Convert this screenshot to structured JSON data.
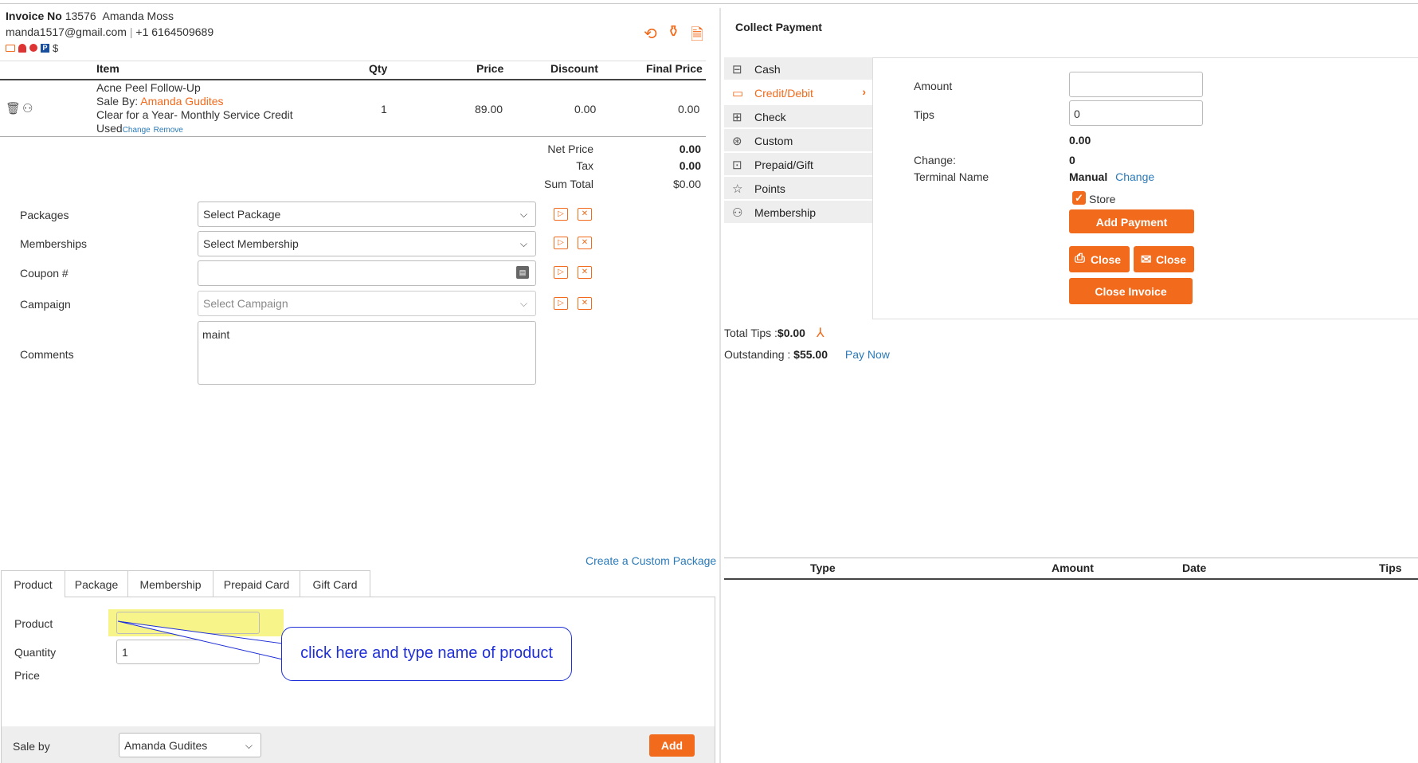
{
  "header": {
    "invoice_label": "Invoice No",
    "invoice_no": "13576",
    "customer": "Amanda Moss",
    "email": "manda1517@gmail.com",
    "separator": "|",
    "phone": "+1 6164509689",
    "dollar": "$"
  },
  "items_table": {
    "columns": [
      "Item",
      "Qty",
      "Price",
      "Discount",
      "Final Price"
    ],
    "row": {
      "name": "Acne Peel Follow-Up",
      "sale_by_label": "Sale By:",
      "sale_by": "Amanda Gudites",
      "note1": "Clear for a Year- Monthly Service Credit",
      "note2": "Used",
      "change": "Change",
      "remove": "Remove",
      "qty": "1",
      "price": "89.00",
      "discount": "0.00",
      "final": "0.00"
    }
  },
  "totals": {
    "net_label": "Net Price",
    "net": "0.00",
    "tax_label": "Tax",
    "tax": "0.00",
    "sum_label": "Sum Total",
    "sum": "$0.00"
  },
  "form": {
    "packages_label": "Packages",
    "packages_value": "Select Package",
    "memberships_label": "Memberships",
    "memberships_value": "Select Membership",
    "coupon_label": "Coupon #",
    "coupon_value": "",
    "campaign_label": "Campaign",
    "campaign_placeholder": "Select Campaign",
    "comments_label": "Comments",
    "comments_value": "maint"
  },
  "custom_package_link": "Create a Custom Package",
  "bottom_tabs": [
    "Product",
    "Package",
    "Membership",
    "Prepaid Card",
    "Gift Card"
  ],
  "product_form": {
    "product_label": "Product",
    "product_value": "",
    "quantity_label": "Quantity",
    "quantity_value": "1",
    "price_label": "Price",
    "callout": "click here and type name of product",
    "sale_by_label": "Sale by",
    "sale_by_value": "Amanda Gudites",
    "add": "Add"
  },
  "payment": {
    "title": "Collect Payment",
    "methods": [
      "Cash",
      "Credit/Debit",
      "Check",
      "Custom",
      "Prepaid/Gift",
      "Points",
      "Membership"
    ],
    "amount_label": "Amount",
    "amount_value": "",
    "tips_label": "Tips",
    "tips_value": "0",
    "tips_computed": "0.00",
    "change_label": "Change:",
    "change_value": "0",
    "terminal_label": "Terminal Name",
    "terminal_value": "Manual",
    "terminal_change": "Change",
    "store_label": "Store",
    "add_payment": "Add Payment",
    "close1": "Close",
    "close2": "Close",
    "close_invoice": "Close Invoice",
    "total_tips_label": "Total Tips :",
    "total_tips": "$0.00",
    "outstanding_label": "Outstanding :",
    "outstanding": "$55.00",
    "pay_now": "Pay Now"
  },
  "payments_table": {
    "columns": [
      "Type",
      "Amount",
      "Date",
      "Tips"
    ]
  },
  "colors": {
    "accent": "#f26a1b",
    "link": "#2a7ab8",
    "callout": "#1f2fd6",
    "highlight": "#f7f58a"
  }
}
